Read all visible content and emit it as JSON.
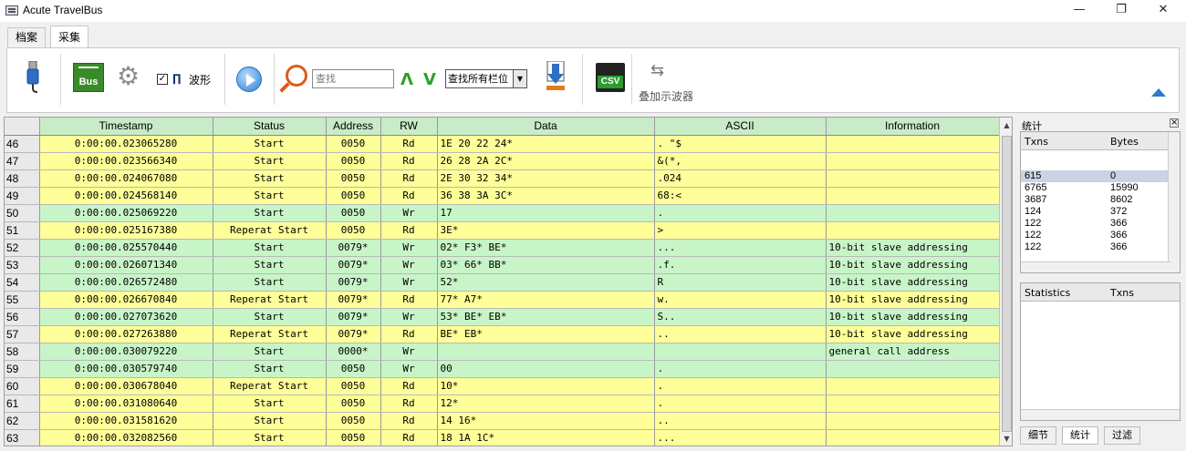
{
  "window": {
    "title": "Acute TravelBus",
    "min": "—",
    "max": "❐",
    "close": "✕"
  },
  "tabs": [
    {
      "label": "档案"
    },
    {
      "label": "采集"
    }
  ],
  "toolbar": {
    "waveform_checkbox_checked": true,
    "waveform_label": "波形",
    "search_placeholder": "查找",
    "search_value": "",
    "find_scope": "查找所有栏位",
    "scope_label": "叠加示波器"
  },
  "grid": {
    "columns": [
      "Timestamp",
      "Status",
      "Address",
      "RW",
      "Data",
      "ASCII",
      "Information"
    ],
    "rows": [
      {
        "n": "46",
        "ts": "0:00:00.023065280",
        "status": "Start",
        "addr": "0050",
        "rw": "Rd",
        "data": "1E 20 22 24*",
        "ascii": ". \"$",
        "info": "",
        "color": "yellow"
      },
      {
        "n": "47",
        "ts": "0:00:00.023566340",
        "status": "Start",
        "addr": "0050",
        "rw": "Rd",
        "data": "26 28 2A 2C*",
        "ascii": "&(*,",
        "info": "",
        "color": "yellow"
      },
      {
        "n": "48",
        "ts": "0:00:00.024067080",
        "status": "Start",
        "addr": "0050",
        "rw": "Rd",
        "data": "2E 30 32 34*",
        "ascii": ".024",
        "info": "",
        "color": "yellow"
      },
      {
        "n": "49",
        "ts": "0:00:00.024568140",
        "status": "Start",
        "addr": "0050",
        "rw": "Rd",
        "data": "36 38 3A 3C*",
        "ascii": "68:<",
        "info": "",
        "color": "yellow"
      },
      {
        "n": "50",
        "ts": "0:00:00.025069220",
        "status": "Start",
        "addr": "0050",
        "rw": "Wr",
        "data": "17",
        "ascii": ".",
        "info": "",
        "color": "green"
      },
      {
        "n": "51",
        "ts": "0:00:00.025167380",
        "status": "Reperat Start",
        "addr": "0050",
        "rw": "Rd",
        "data": "3E*",
        "ascii": ">",
        "info": "",
        "color": "yellow"
      },
      {
        "n": "52",
        "ts": "0:00:00.025570440",
        "status": "Start",
        "addr": "0079*",
        "rw": "Wr",
        "data": "02* F3* BE*",
        "ascii": "...",
        "info": "10-bit slave addressing",
        "color": "green"
      },
      {
        "n": "53",
        "ts": "0:00:00.026071340",
        "status": "Start",
        "addr": "0079*",
        "rw": "Wr",
        "data": "03* 66* BB*",
        "ascii": ".f.",
        "info": "10-bit slave addressing",
        "color": "green"
      },
      {
        "n": "54",
        "ts": "0:00:00.026572480",
        "status": "Start",
        "addr": "0079*",
        "rw": "Wr",
        "data": "52*",
        "ascii": "R",
        "info": "10-bit slave addressing",
        "color": "green"
      },
      {
        "n": "55",
        "ts": "0:00:00.026670840",
        "status": "Reperat Start",
        "addr": "0079*",
        "rw": "Rd",
        "data": "77* A7*",
        "ascii": "w.",
        "info": "10-bit slave addressing",
        "color": "yellow"
      },
      {
        "n": "56",
        "ts": "0:00:00.027073620",
        "status": "Start",
        "addr": "0079*",
        "rw": "Wr",
        "data": "53* BE* EB*",
        "ascii": "S..",
        "info": "10-bit slave addressing",
        "color": "green"
      },
      {
        "n": "57",
        "ts": "0:00:00.027263880",
        "status": "Reperat Start",
        "addr": "0079*",
        "rw": "Rd",
        "data": "BE* EB*",
        "ascii": "..",
        "info": "10-bit slave addressing",
        "color": "yellow"
      },
      {
        "n": "58",
        "ts": "0:00:00.030079220",
        "status": "Start",
        "addr": "0000*",
        "rw": "Wr",
        "data": "",
        "ascii": "",
        "info": "general call address",
        "color": "green"
      },
      {
        "n": "59",
        "ts": "0:00:00.030579740",
        "status": "Start",
        "addr": "0050",
        "rw": "Wr",
        "data": "00",
        "ascii": ".",
        "info": "",
        "color": "green"
      },
      {
        "n": "60",
        "ts": "0:00:00.030678040",
        "status": "Reperat Start",
        "addr": "0050",
        "rw": "Rd",
        "data": "10*",
        "ascii": ".",
        "info": "",
        "color": "yellow"
      },
      {
        "n": "61",
        "ts": "0:00:00.031080640",
        "status": "Start",
        "addr": "0050",
        "rw": "Rd",
        "data": "12*",
        "ascii": ".",
        "info": "",
        "color": "yellow"
      },
      {
        "n": "62",
        "ts": "0:00:00.031581620",
        "status": "Start",
        "addr": "0050",
        "rw": "Rd",
        "data": "14 16*",
        "ascii": "..",
        "info": "",
        "color": "yellow"
      },
      {
        "n": "63",
        "ts": "0:00:00.032082560",
        "status": "Start",
        "addr": "0050",
        "rw": "Rd",
        "data": "18 1A 1C*",
        "ascii": "...",
        "info": "",
        "color": "yellow"
      }
    ]
  },
  "stats_panel": {
    "title": "统计",
    "headers": [
      "Txns",
      "Bytes"
    ],
    "rows": [
      {
        "txns": "615",
        "bytes": "0",
        "selected": true
      },
      {
        "txns": "6765",
        "bytes": "15990"
      },
      {
        "txns": "3687",
        "bytes": "8602"
      },
      {
        "txns": "124",
        "bytes": "372"
      },
      {
        "txns": "122",
        "bytes": "366"
      },
      {
        "txns": "122",
        "bytes": "366"
      },
      {
        "txns": "122",
        "bytes": "366"
      }
    ],
    "headers2": [
      "Statistics",
      "Txns"
    ],
    "bottom_tabs": [
      "细节",
      "统计",
      "过滤"
    ]
  }
}
